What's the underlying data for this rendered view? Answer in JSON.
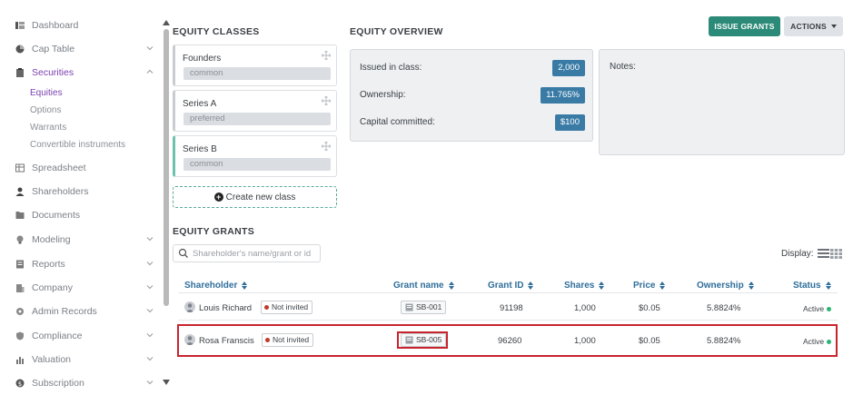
{
  "sidebar": {
    "items": [
      {
        "label": "Dashboard"
      },
      {
        "label": "Cap Table"
      },
      {
        "label": "Securities"
      },
      {
        "label": "Spreadsheet"
      },
      {
        "label": "Shareholders"
      },
      {
        "label": "Documents"
      },
      {
        "label": "Modeling"
      },
      {
        "label": "Reports"
      },
      {
        "label": "Company"
      },
      {
        "label": "Admin Records"
      },
      {
        "label": "Compliance"
      },
      {
        "label": "Valuation"
      },
      {
        "label": "Subscription"
      }
    ],
    "securities_sub": [
      {
        "label": "Equities"
      },
      {
        "label": "Options"
      },
      {
        "label": "Warrants"
      },
      {
        "label": "Convertible instruments"
      }
    ]
  },
  "equity_classes": {
    "title": "EQUITY CLASSES",
    "classes": [
      {
        "name": "Founders",
        "type": "common"
      },
      {
        "name": "Series A",
        "type": "preferred"
      },
      {
        "name": "Series B",
        "type": "common"
      }
    ],
    "create_label": "Create new class"
  },
  "overview": {
    "title": "EQUITY OVERVIEW",
    "issued_label": "Issued in class:",
    "issued_value": "2,000",
    "ownership_label": "Ownership:",
    "ownership_value": "11.765%",
    "capital_label": "Capital committed:",
    "capital_value": "$100",
    "notes_label": "Notes:"
  },
  "toolbar": {
    "issue_label": "ISSUE GRANTS",
    "actions_label": "ACTIONS"
  },
  "grants": {
    "title": "EQUITY GRANTS",
    "search_placeholder": "Shareholder's name/grant or id",
    "display_label": "Display:",
    "columns": [
      "Shareholder",
      "Grant name",
      "Grant ID",
      "Shares",
      "Price",
      "Ownership",
      "Status"
    ],
    "rows": [
      {
        "shareholder": "Louis Richard",
        "invite": "Not invited",
        "grant_name": "SB-001",
        "grant_id": "91198",
        "shares": "1,000",
        "price": "$0.05",
        "ownership": "5.8824%",
        "status": "Active"
      },
      {
        "shareholder": "Rosa Franscis",
        "invite": "Not invited",
        "grant_name": "SB-005",
        "grant_id": "96260",
        "shares": "1,000",
        "price": "$0.05",
        "ownership": "5.8824%",
        "status": "Active"
      }
    ]
  },
  "colors": {
    "accent_purple": "#7b3fb0",
    "teal": "#2c8a78",
    "value_blue": "#3a7ba6",
    "header_blue": "#2f6e9a",
    "highlight_red": "#c8242e"
  }
}
